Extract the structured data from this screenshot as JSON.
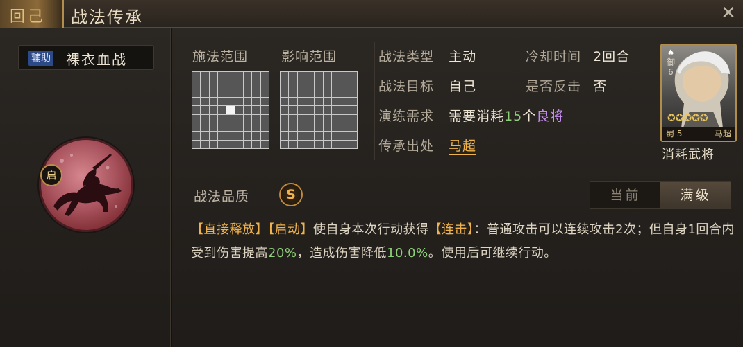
{
  "window": {
    "title": "战法传承",
    "ornament_text": "回己"
  },
  "skill": {
    "type_tag": "辅助",
    "name": "裸衣血战",
    "emblem_badge": "启"
  },
  "ranges": {
    "cast_label": "施法范围",
    "effect_label": "影响范围"
  },
  "info": {
    "type_label": "战法类型",
    "type_value": "主动",
    "cooldown_label": "冷却时间",
    "cooldown_value": "2回合",
    "target_label": "战法目标",
    "target_value": "自己",
    "counter_label": "是否反击",
    "counter_value": "否",
    "train_label": "演练需求",
    "train_prefix": "需要消耗",
    "train_count": "15",
    "train_unit": "个",
    "train_item": "良将",
    "source_label": "传承出处",
    "source_value": "马超"
  },
  "general_card": {
    "faction_top": "御",
    "cost": "6",
    "stars": "✪✪✪✪✪",
    "kingdom": "蜀",
    "level": "5",
    "name": "马超",
    "label": "消耗武将"
  },
  "quality": {
    "label": "战法品质",
    "grade": "S"
  },
  "level_toggle": {
    "current": "当前",
    "max": "满级"
  },
  "description": {
    "tag1": "【直接释放】",
    "tag2": "【启动】",
    "text1": "使自身本次行动获得",
    "tag3": "【连击】",
    "text2": "：普通攻击可以连续攻击2次；但自身1回合内受到伤害提高",
    "val1": "20%",
    "text3": "，造成伤害降低",
    "val2": "10.0%",
    "text4": "。使用后可继续行动。"
  },
  "colors": {
    "accent_gold": "#f0b24b",
    "number_green": "#8ed07a",
    "purple": "#c68cf2",
    "tag_blue": "#2c4a88"
  }
}
